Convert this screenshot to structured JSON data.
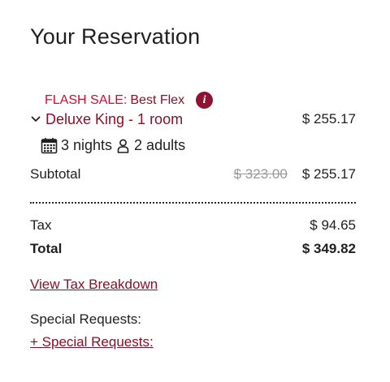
{
  "reservation": {
    "title": "Your Reservation",
    "sale": {
      "label": "FLASH SALE:",
      "name": "Best Flex",
      "info_icon": "i"
    },
    "room": {
      "name": "Deluxe King - 1 room",
      "price": "$ 255.17"
    },
    "details": {
      "nights": "3 nights",
      "guests": "2 adults"
    },
    "subtotal": {
      "label": "Subtotal",
      "original": "$ 323.00",
      "value": "$ 255.17"
    },
    "tax": {
      "label": "Tax",
      "value": "$ 94.65"
    },
    "total": {
      "label": "Total",
      "value": "$ 349.82"
    },
    "tax_breakdown_link": "View Tax Breakdown",
    "special_requests": {
      "label": "Special Requests:",
      "link": "+ Special Requests:"
    }
  },
  "colors": {
    "sale_red": "#c8102e",
    "brand_maroon": "#8a1026",
    "info_icon_bg": "#8f1330",
    "text": "#1f1f1f",
    "strike_gray": "#9a9a9a"
  }
}
